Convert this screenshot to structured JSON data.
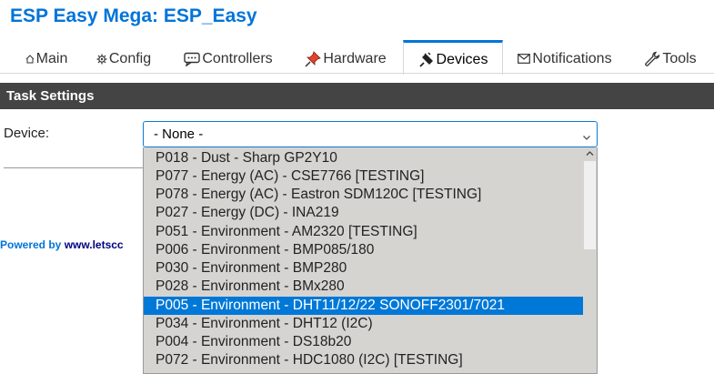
{
  "app": {
    "title": "ESP Easy Mega: ESP_Easy"
  },
  "tabs": [
    {
      "label": "Main",
      "icon": "home-icon"
    },
    {
      "label": "Config",
      "icon": "gear-icon"
    },
    {
      "label": "Controllers",
      "icon": "chat-icon"
    },
    {
      "label": "Hardware",
      "icon": "pin-icon"
    },
    {
      "label": "Devices",
      "icon": "plug-icon",
      "active": true
    },
    {
      "label": "Notifications",
      "icon": "envelope-icon"
    },
    {
      "label": "Tools",
      "icon": "wrench-icon"
    }
  ],
  "section": {
    "title": "Task Settings"
  },
  "device": {
    "label": "Device:",
    "selected_value": "- None -"
  },
  "dropdown": {
    "options": [
      "P018 - Dust - Sharp GP2Y10",
      "P077 - Energy (AC) - CSE7766 [TESTING]",
      "P078 - Energy (AC) - Eastron SDM120C [TESTING]",
      "P027 - Energy (DC) - INA219",
      "P051 - Environment - AM2320 [TESTING]",
      "P006 - Environment - BMP085/180",
      "P030 - Environment - BMP280",
      "P028 - Environment - BMx280",
      "P005 - Environment - DHT11/12/22 SONOFF2301/7021",
      "P034 - Environment - DHT12 (I2C)",
      "P004 - Environment - DS18b20",
      "P072 - Environment - HDC1080 (I2C) [TESTING]"
    ],
    "highlighted_index": 8
  },
  "footer": {
    "prefix": "Powered by ",
    "link_text": "www.letscc"
  },
  "colors": {
    "accent": "#0074d9",
    "header_bg": "#444444",
    "highlight": "#0078d7"
  }
}
